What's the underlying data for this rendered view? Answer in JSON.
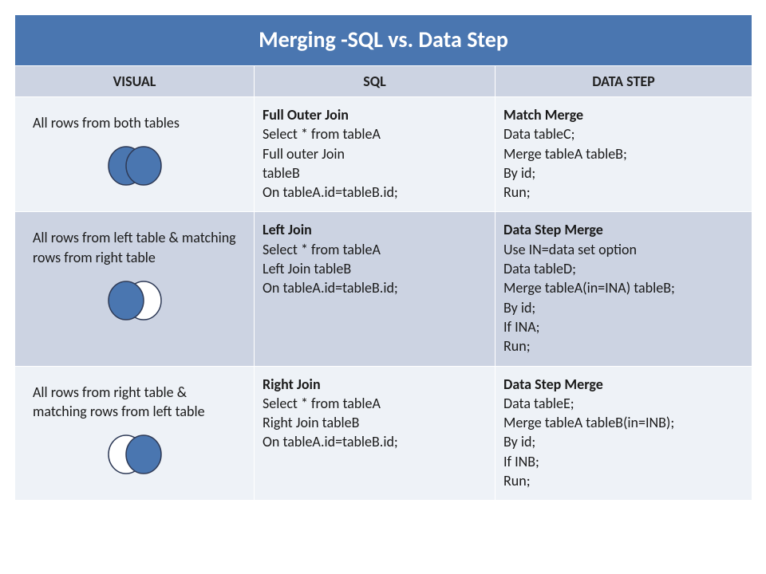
{
  "title": "Merging -SQL vs. Data Step",
  "headers": {
    "visual": "VISUAL",
    "sql": "SQL",
    "datastep": "DATA STEP"
  },
  "colors": {
    "header_bg": "#4a76b0",
    "subheader_bg": "#ccd3e2",
    "light_bg": "#eef2f7",
    "dark_bg": "#ccd3e2",
    "venn_fill": "#4a76b0",
    "venn_stroke": "#2f3b57"
  },
  "rows": [
    {
      "visual_caption": "All rows from both tables",
      "venn": {
        "left_fill": true,
        "right_fill": true
      },
      "sql": {
        "title": "Full Outer Join",
        "lines": [
          "Select * from tableA",
          "Full outer Join",
          "tableB",
          "On tableA.id=tableB.id;"
        ]
      },
      "datastep": {
        "title": "Match Merge",
        "lines": [
          "Data tableC;",
          "Merge tableA tableB;",
          "By id;",
          "Run;"
        ]
      }
    },
    {
      "visual_caption": "All rows from left table & matching rows from right table",
      "venn": {
        "left_fill": true,
        "right_fill": false
      },
      "sql": {
        "title": "Left Join",
        "lines": [
          "Select * from tableA",
          "Left Join tableB",
          "On tableA.id=tableB.id;"
        ]
      },
      "datastep": {
        "title": "Data Step Merge",
        "lines": [
          "Use IN=data set option",
          "Data tableD;",
          "Merge tableA(in=INA) tableB;",
          "By id;",
          "If INA;",
          "Run;"
        ]
      }
    },
    {
      "visual_caption": "All rows from right table & matching rows from left table",
      "venn": {
        "left_fill": false,
        "right_fill": true
      },
      "sql": {
        "title": "Right Join",
        "lines": [
          "Select * from tableA",
          "Right Join tableB",
          "On tableA.id=tableB.id;"
        ]
      },
      "datastep": {
        "title": "Data Step Merge",
        "lines": [
          "Data tableE;",
          "Merge tableA tableB(in=INB);",
          "By id;",
          "If INB;",
          "Run;"
        ]
      }
    }
  ]
}
